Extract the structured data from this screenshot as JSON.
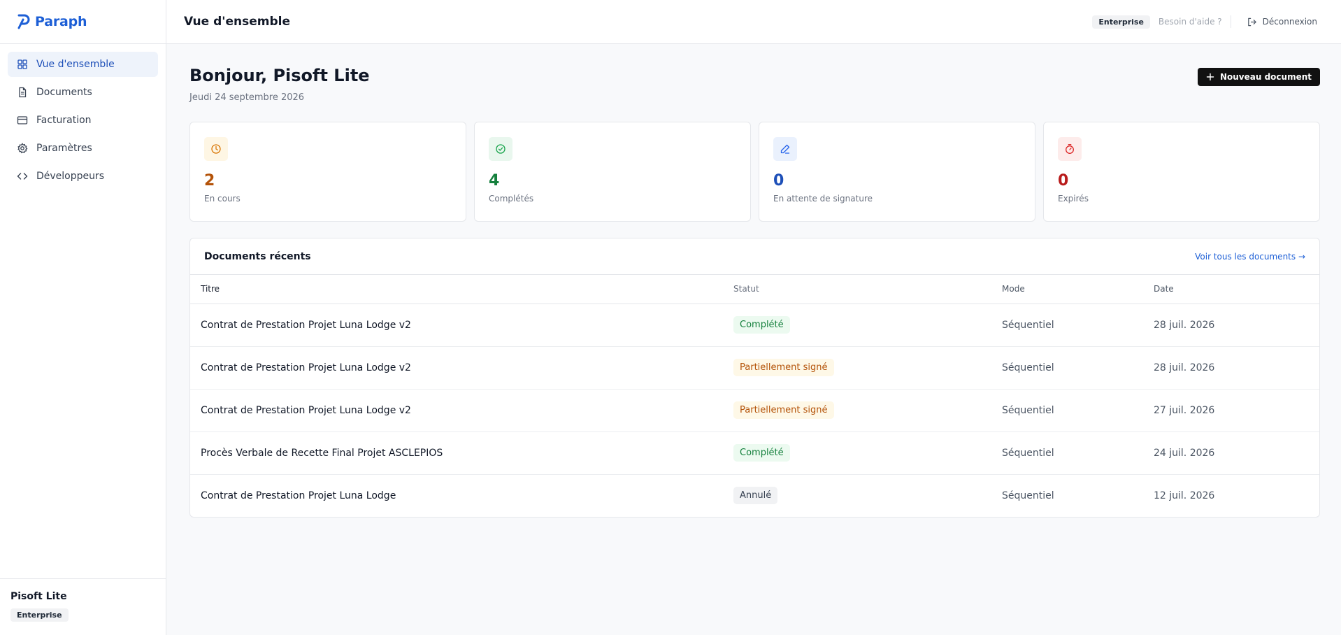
{
  "brand": {
    "name": "Paraph",
    "color": "#1d5fd6"
  },
  "sidebar": {
    "items": [
      {
        "label": "Vue d'ensemble",
        "icon": "grid-icon",
        "active": true
      },
      {
        "label": "Documents",
        "icon": "file-icon"
      },
      {
        "label": "Facturation",
        "icon": "credit-card-icon"
      },
      {
        "label": "Paramètres",
        "icon": "gear-icon"
      },
      {
        "label": "Développeurs",
        "icon": "code-icon"
      }
    ],
    "footer": {
      "user": "Pisoft Lite",
      "plan": "Enterprise"
    }
  },
  "header": {
    "title": "Vue d'ensemble",
    "plan_badge": "Enterprise",
    "help": "Besoin d'aide ?",
    "logout": "Déconnexion"
  },
  "main": {
    "greeting": "Bonjour, Pisoft Lite",
    "date": "Jeudi 24 septembre 2026",
    "new_document": "Nouveau document"
  },
  "stats": [
    {
      "value": "2",
      "label": "En cours",
      "icon": "clock-icon",
      "color": "#b45309",
      "bg": "#fef6e4",
      "icon_color": "#d97706"
    },
    {
      "value": "4",
      "label": "Complétés",
      "icon": "check-circle-icon",
      "color": "#15803d",
      "bg": "#e9f7ee",
      "icon_color": "#16a34a"
    },
    {
      "value": "0",
      "label": "En attente de signature",
      "icon": "pen-icon",
      "color": "#1d4fb8",
      "bg": "#eaf1fd",
      "icon_color": "#2563eb"
    },
    {
      "value": "0",
      "label": "Expirés",
      "icon": "timer-icon",
      "color": "#b91c1c",
      "bg": "#fdeceb",
      "icon_color": "#dc2626"
    }
  ],
  "recent": {
    "title": "Documents récents",
    "see_all": "Voir tous les documents →",
    "columns": [
      "Titre",
      "Statut",
      "Mode",
      "Date"
    ],
    "rows": [
      {
        "title": "Contrat de Prestation Projet Luna Lodge v2",
        "status": "Complété",
        "status_kind": "ok",
        "mode": "Séquentiel",
        "date": "28 juil. 2026"
      },
      {
        "title": "Contrat de Prestation Projet Luna Lodge v2",
        "status": "Partiellement signé",
        "status_kind": "partial",
        "mode": "Séquentiel",
        "date": "28 juil. 2026"
      },
      {
        "title": "Contrat de Prestation Projet Luna Lodge v2",
        "status": "Partiellement signé",
        "status_kind": "partial",
        "mode": "Séquentiel",
        "date": "27 juil. 2026"
      },
      {
        "title": "Procès Verbale de Recette Final Projet ASCLEPIOS",
        "status": "Complété",
        "status_kind": "ok",
        "mode": "Séquentiel",
        "date": "24 juil. 2026"
      },
      {
        "title": "Contrat de Prestation Projet Luna Lodge",
        "status": "Annulé",
        "status_kind": "cancel",
        "mode": "Séquentiel",
        "date": "12 juil. 2026"
      }
    ]
  }
}
